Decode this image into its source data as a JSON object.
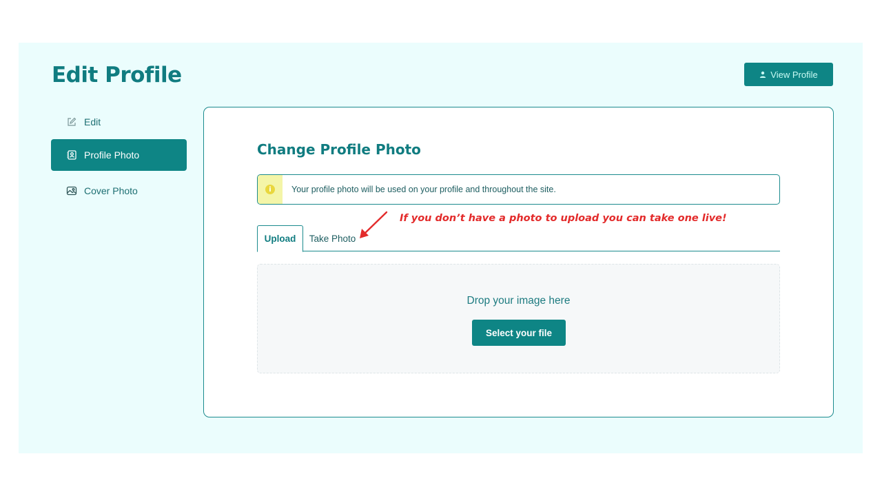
{
  "page": {
    "title": "Edit Profile",
    "view_profile_label": "View Profile"
  },
  "sidebar": {
    "items": [
      {
        "label": "Edit",
        "icon": "pencil-square-icon",
        "active": false
      },
      {
        "label": "Profile Photo",
        "icon": "contact-card-icon",
        "active": true
      },
      {
        "label": "Cover Photo",
        "icon": "image-icon",
        "active": false
      }
    ]
  },
  "main": {
    "title": "Change Profile Photo",
    "notice": "Your profile photo will be used on your profile and throughout the site.",
    "annotation": "If you don’t have a photo to upload you can take one live!",
    "tabs": [
      {
        "label": "Upload",
        "active": true
      },
      {
        "label": "Take Photo",
        "active": false
      }
    ],
    "dropzone": {
      "text": "Drop your image here",
      "button_label": "Select your file"
    }
  },
  "colors": {
    "accent": "#0e8585",
    "panel_bg": "#ebfdfd",
    "annotation": "#e32b2b",
    "notice_bar": "#f4f5a8"
  }
}
